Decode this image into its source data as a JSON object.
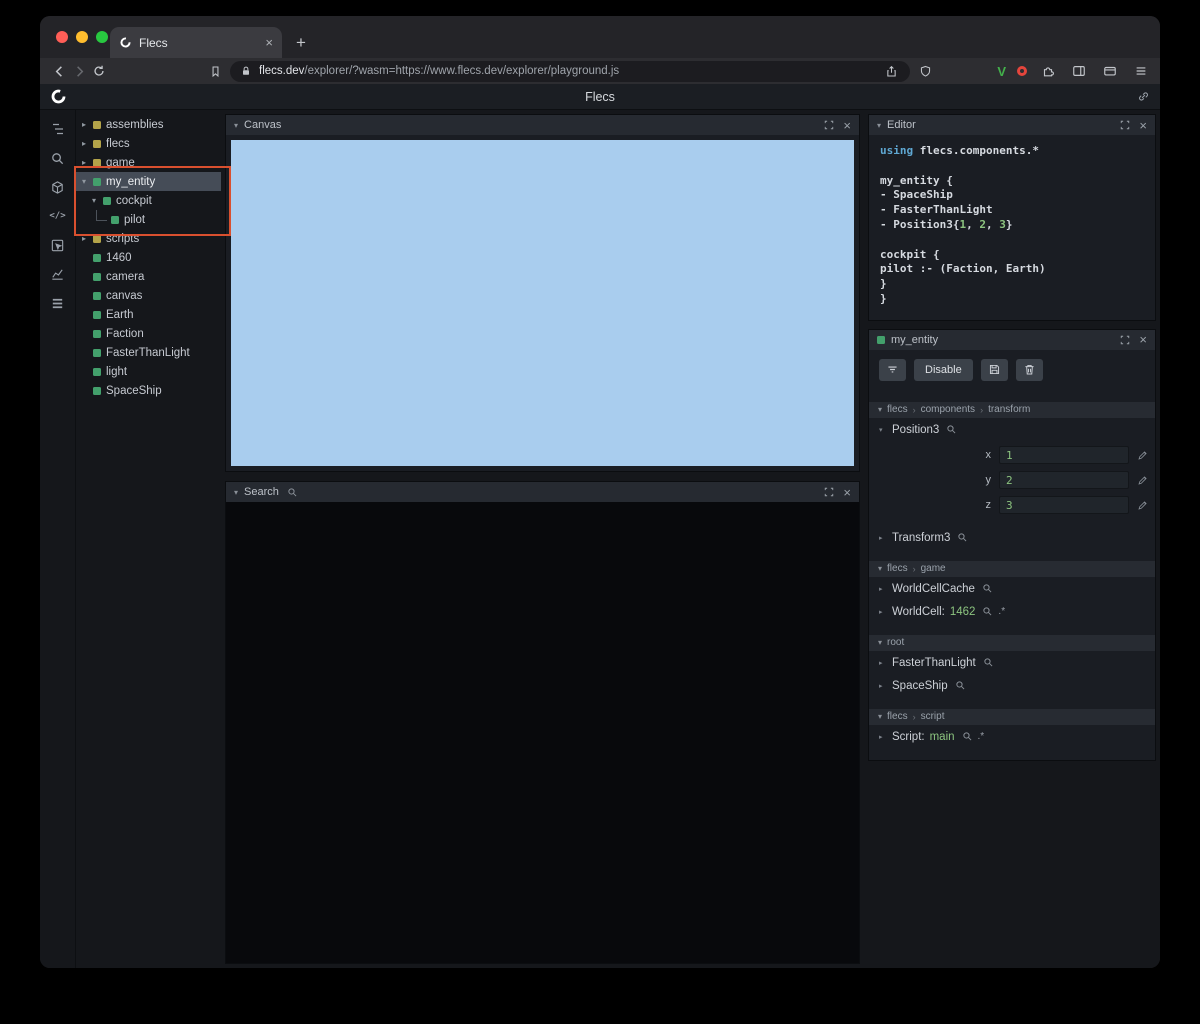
{
  "browser": {
    "tab": {
      "title": "Flecs"
    },
    "url_domain": "flecs.dev",
    "url_path": "/explorer/?wasm=https://www.flecs.dev/explorer/playground.js"
  },
  "app": {
    "title": "Flecs",
    "tree": {
      "items": [
        {
          "label": "assemblies",
          "depth": 0,
          "arrow": "right",
          "color": "yellow"
        },
        {
          "label": "flecs",
          "depth": 0,
          "arrow": "right",
          "color": "yellow"
        },
        {
          "label": "game",
          "depth": 0,
          "arrow": "right",
          "color": "yellow"
        },
        {
          "label": "my_entity",
          "depth": 0,
          "arrow": "down",
          "color": "green",
          "selected": true
        },
        {
          "label": "cockpit",
          "depth": 1,
          "arrow": "down",
          "color": "green"
        },
        {
          "label": "pilot",
          "depth": 1,
          "arrow": "none",
          "color": "green",
          "connector": true
        },
        {
          "label": "scripts",
          "depth": 0,
          "arrow": "right",
          "color": "yellow"
        },
        {
          "label": "1460",
          "depth": 0,
          "arrow": "none",
          "color": "green"
        },
        {
          "label": "camera",
          "depth": 0,
          "arrow": "none",
          "color": "green"
        },
        {
          "label": "canvas",
          "depth": 0,
          "arrow": "none",
          "color": "green"
        },
        {
          "label": "Earth",
          "depth": 0,
          "arrow": "none",
          "color": "green"
        },
        {
          "label": "Faction",
          "depth": 0,
          "arrow": "none",
          "color": "green"
        },
        {
          "label": "FasterThanLight",
          "depth": 0,
          "arrow": "none",
          "color": "green"
        },
        {
          "label": "light",
          "depth": 0,
          "arrow": "none",
          "color": "green"
        },
        {
          "label": "SpaceShip",
          "depth": 0,
          "arrow": "none",
          "color": "green"
        }
      ]
    },
    "canvas_panel": {
      "title": "Canvas"
    },
    "search_panel": {
      "title": "Search"
    },
    "editor_panel": {
      "title": "Editor",
      "lines": [
        [
          {
            "t": "using",
            "c": "kw"
          },
          {
            "t": " flecs.components.*",
            "c": "d"
          }
        ],
        [],
        [
          {
            "t": "my_entity {",
            "c": "d"
          }
        ],
        [
          {
            "t": "  - SpaceShip",
            "c": "d"
          }
        ],
        [
          {
            "t": "  - FasterThanLight",
            "c": "d"
          }
        ],
        [
          {
            "t": "  - Position3{",
            "c": "d"
          },
          {
            "t": "1",
            "c": "num"
          },
          {
            "t": ", ",
            "c": "d"
          },
          {
            "t": "2",
            "c": "num"
          },
          {
            "t": ", ",
            "c": "d"
          },
          {
            "t": "3",
            "c": "num"
          },
          {
            "t": "}",
            "c": "d"
          }
        ],
        [],
        [
          {
            "t": "  cockpit {",
            "c": "d"
          }
        ],
        [
          {
            "t": "    pilot :- (Faction, Earth)",
            "c": "d"
          }
        ],
        [
          {
            "t": "  }",
            "c": "d"
          }
        ],
        [
          {
            "t": "}",
            "c": "d"
          }
        ]
      ]
    },
    "inspector": {
      "title": "my_entity",
      "disable_label": "Disable",
      "sections": [
        {
          "path": [
            "flecs",
            "components",
            "transform"
          ],
          "items": [
            {
              "label": "Position3",
              "expanded": true,
              "has_search": true,
              "fields": [
                {
                  "name": "x",
                  "value": "1"
                },
                {
                  "name": "y",
                  "value": "2"
                },
                {
                  "name": "z",
                  "value": "3"
                }
              ]
            },
            {
              "label": "Transform3",
              "has_search": true
            }
          ]
        },
        {
          "path": [
            "flecs",
            "game"
          ],
          "items": [
            {
              "label": "WorldCellCache",
              "has_search": true
            },
            {
              "label": "WorldCell:",
              "value": "1462",
              "has_search": true,
              "suffix": ".*"
            }
          ]
        },
        {
          "path": [
            "root"
          ],
          "items": [
            {
              "label": "FasterThanLight",
              "has_search": true
            },
            {
              "label": "SpaceShip",
              "has_search": true
            }
          ]
        },
        {
          "path": [
            "flecs",
            "script"
          ],
          "items": [
            {
              "label": "Script:",
              "value": "main",
              "has_search": true,
              "suffix": ".*"
            }
          ]
        }
      ]
    }
  },
  "colors": {
    "canvas_blue": "#a9cdee",
    "entity_green": "#43a06c",
    "module_yellow": "#b3a349",
    "annotation_red": "#d9502f",
    "value_green": "#8cc47f",
    "keyword_blue": "#5fa8d3"
  }
}
